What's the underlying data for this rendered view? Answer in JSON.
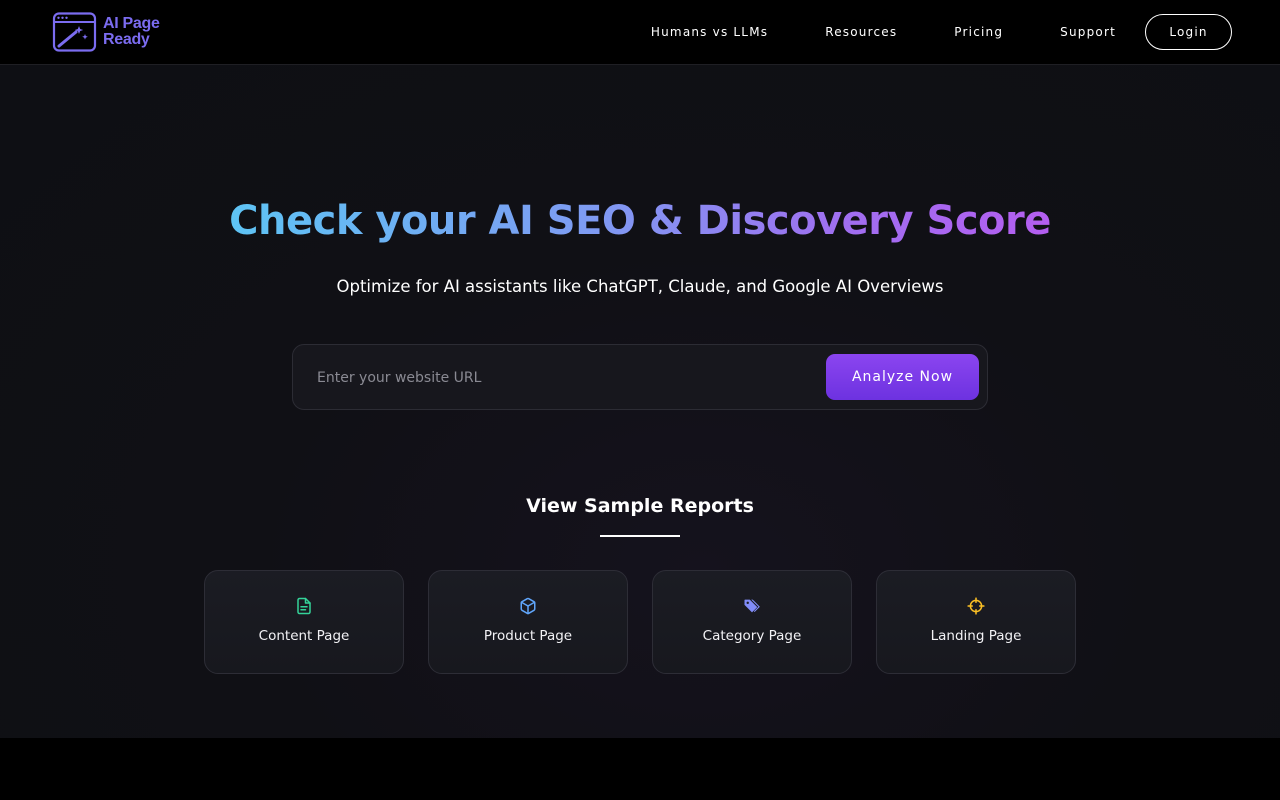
{
  "header": {
    "logo_line1": "AI Page",
    "logo_line2": "Ready",
    "nav": [
      "Humans vs LLMs",
      "Resources",
      "Pricing",
      "Support"
    ],
    "login_label": "Login",
    "logo_color": "#7b6cf0"
  },
  "hero": {
    "title": "Check your AI SEO & Discovery Score",
    "subtitle": "Optimize for AI assistants like ChatGPT, Claude, and Google AI Overviews",
    "search_placeholder": "Enter your website URL",
    "search_value": "",
    "analyze_label": "Analyze Now",
    "accent_color": "#7c3aed"
  },
  "samples": {
    "title": "View Sample Reports",
    "cards": [
      {
        "label": "Content Page",
        "icon": "document-icon",
        "color": "#34d399"
      },
      {
        "label": "Product Page",
        "icon": "cube-icon",
        "color": "#60a5fa"
      },
      {
        "label": "Category Page",
        "icon": "tag-icon",
        "color": "#818cf8"
      },
      {
        "label": "Landing Page",
        "icon": "crosshair-icon",
        "color": "#fbbf24"
      }
    ]
  }
}
